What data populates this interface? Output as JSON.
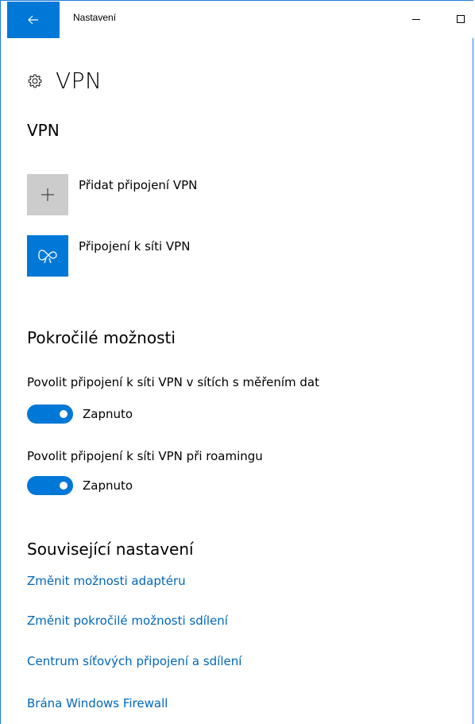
{
  "window": {
    "title": "Nastavení",
    "accent": "#0078d7",
    "back_icon": "arrow-left-icon",
    "minimize_icon": "minimize-icon",
    "maximize_icon": "maximize-icon"
  },
  "page": {
    "icon": "gear-icon",
    "title": "VPN"
  },
  "vpn_section": {
    "title": "VPN",
    "items": [
      {
        "icon": "plus-icon",
        "label": "Přidat připojení VPN"
      },
      {
        "icon": "vpn-icon",
        "label": "Připojení k síti VPN"
      }
    ]
  },
  "advanced": {
    "title": "Pokročilé možnosti",
    "options": [
      {
        "label": "Povolit připojení k síti VPN v sítích s měřením dat",
        "state": "Zapnuto",
        "on": true
      },
      {
        "label": "Povolit připojení k síti VPN při roamingu",
        "state": "Zapnuto",
        "on": true
      }
    ]
  },
  "related": {
    "title": "Související nastavení",
    "links": [
      "Změnit možnosti adaptéru",
      "Změnit pokročilé možnosti sdílení",
      "Centrum síťových připojení a sdílení",
      "Brána Windows Firewall"
    ]
  }
}
